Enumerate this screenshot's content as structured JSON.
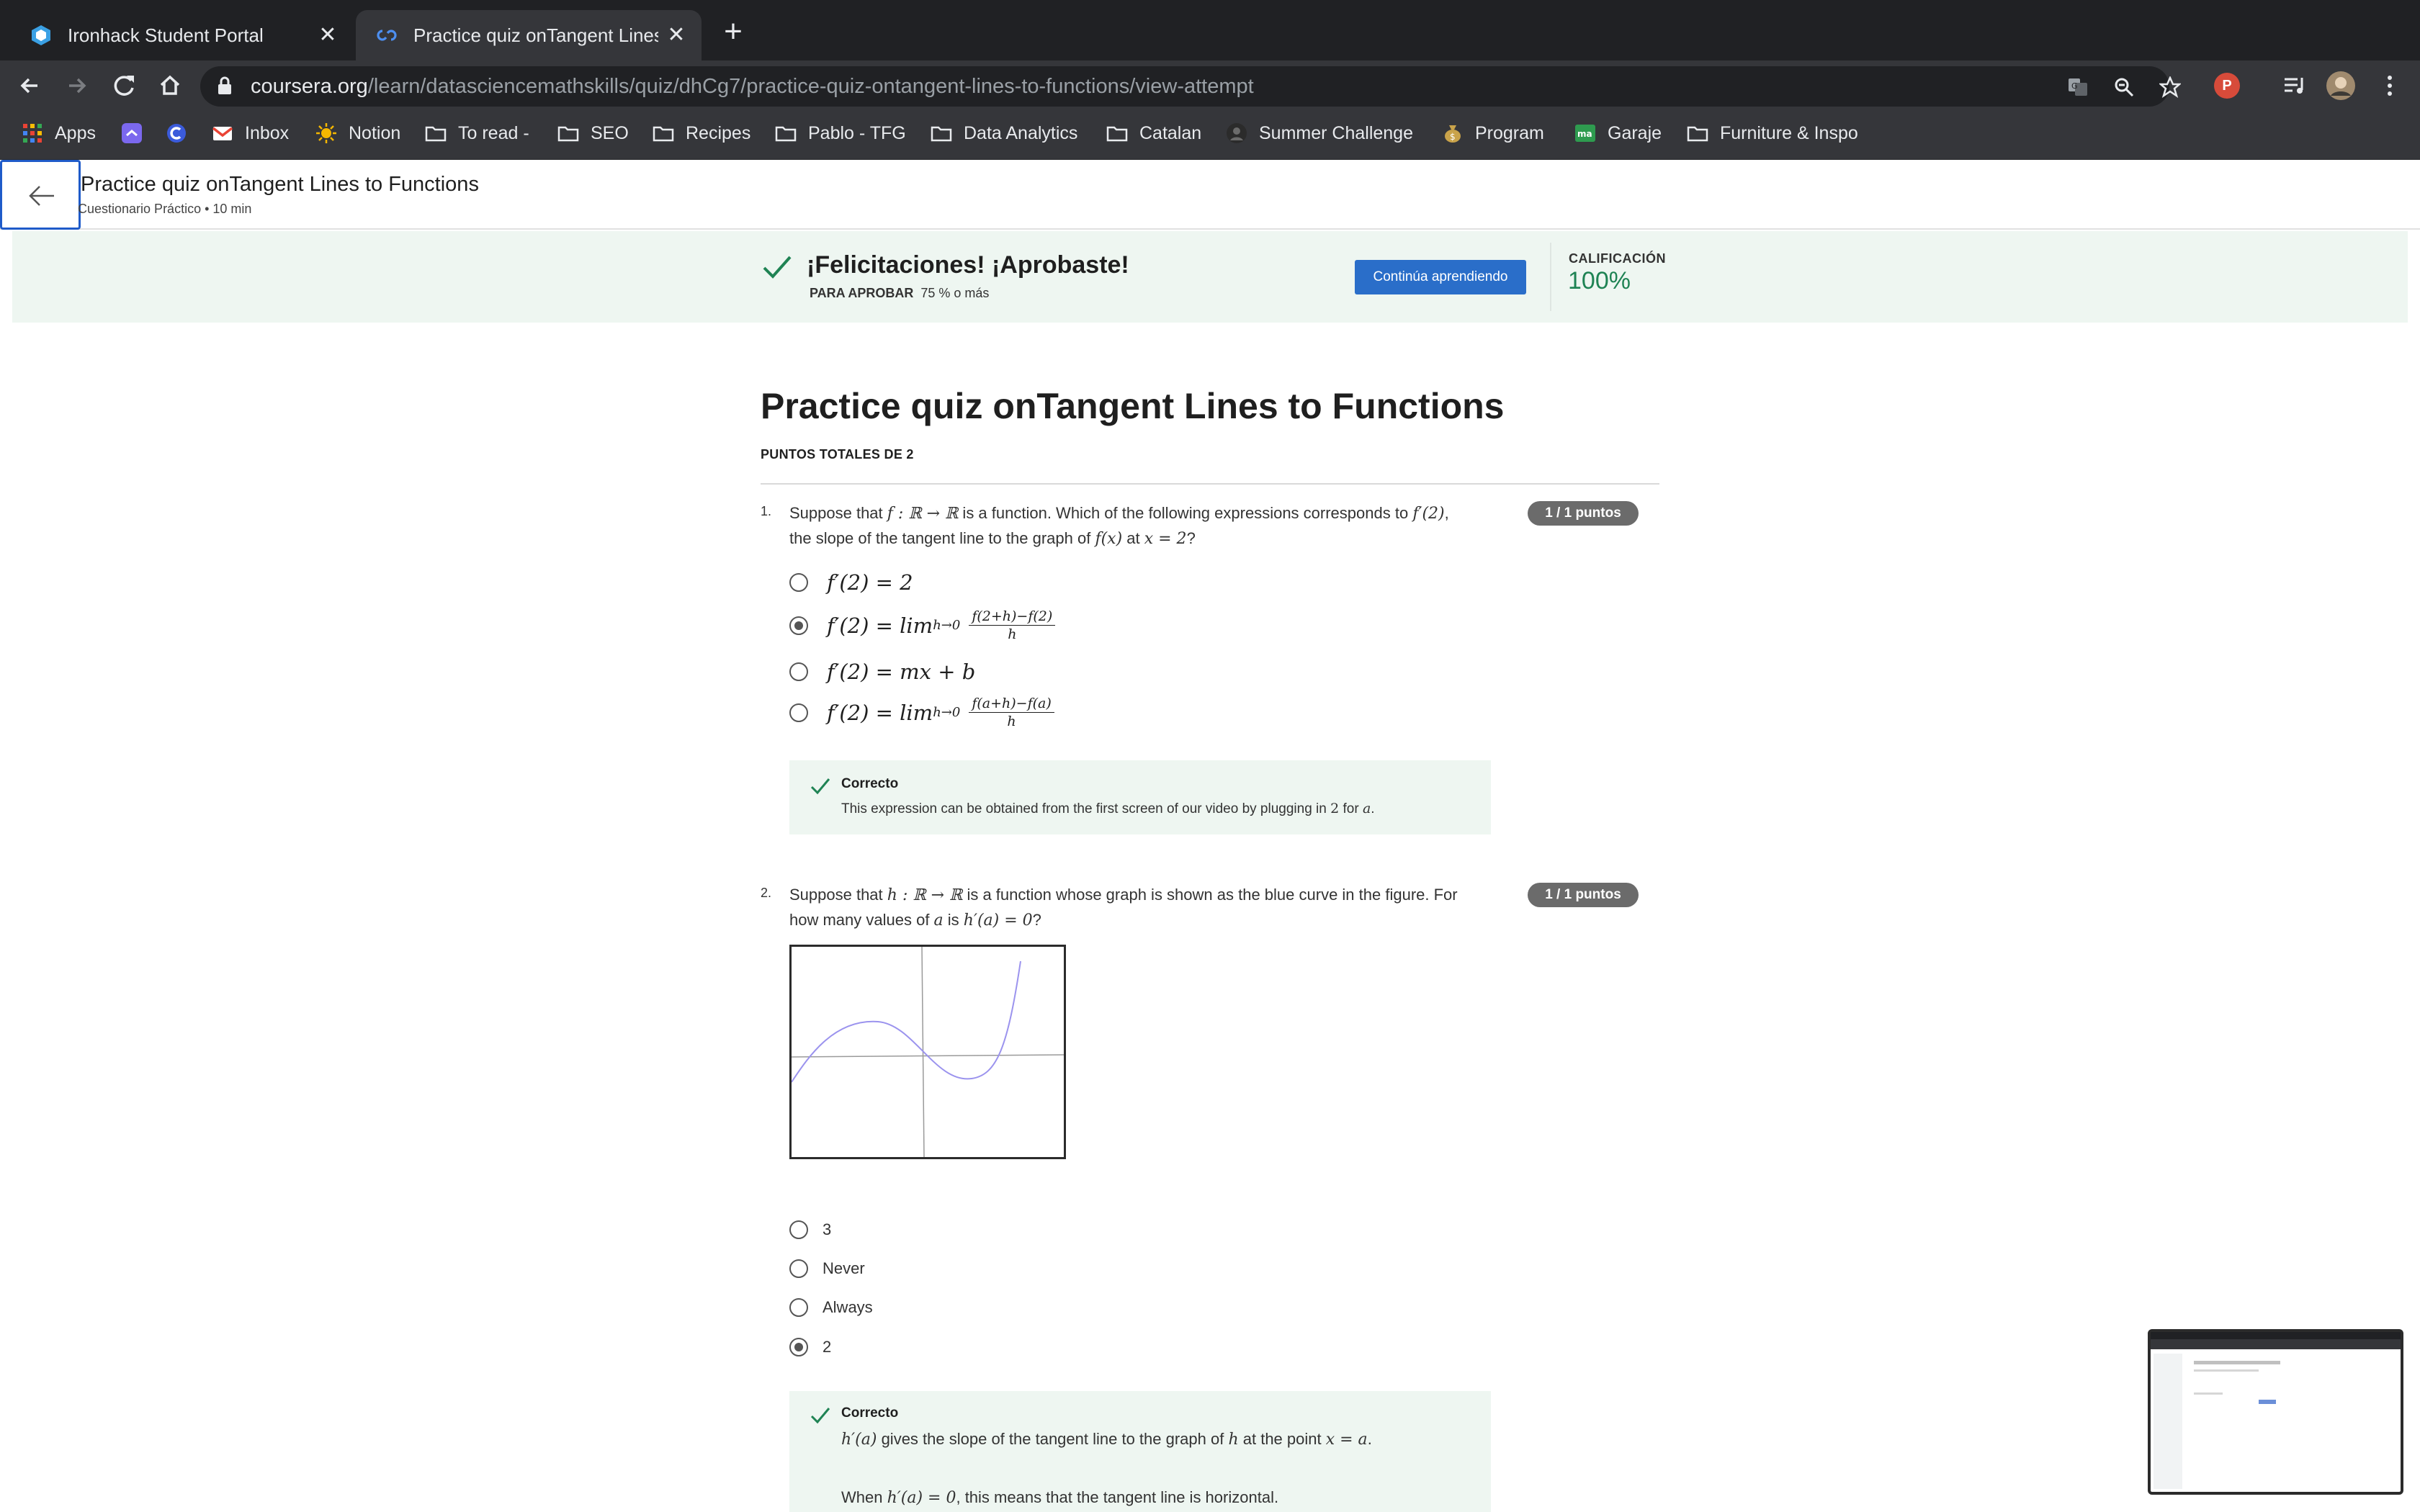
{
  "browser": {
    "tabs": [
      {
        "title": "Ironhack Student Portal",
        "active": false
      },
      {
        "title": "Practice quiz onTangent Lines to Functions",
        "active": true
      }
    ],
    "url_host": "coursera.org",
    "url_path": "/learn/datasciencemathskills/quiz/dhCg7/practice-quiz-ontangent-lines-to-functions/view-attempt",
    "profile_initial": "P",
    "bookmarks": [
      {
        "label": "Apps",
        "icon": "apps-grid-icon"
      },
      {
        "label": "",
        "icon": "clickup-icon"
      },
      {
        "label": "",
        "icon": "c-logo-icon"
      },
      {
        "label": "Inbox",
        "icon": "gmail-icon"
      },
      {
        "label": "Notion",
        "icon": "sun-icon"
      },
      {
        "label": "To read -",
        "icon": "folder-icon"
      },
      {
        "label": "SEO",
        "icon": "folder-icon"
      },
      {
        "label": "Recipes",
        "icon": "folder-icon"
      },
      {
        "label": "Pablo - TFG",
        "icon": "folder-icon"
      },
      {
        "label": "Data Analytics",
        "icon": "folder-icon"
      },
      {
        "label": "Catalan",
        "icon": "folder-icon"
      },
      {
        "label": "Summer Challenge",
        "icon": "avatar-icon"
      },
      {
        "label": "Program",
        "icon": "money-bag-icon"
      },
      {
        "label": "Garaje",
        "icon": "ma-logo-icon"
      },
      {
        "label": "Furniture & Inspo",
        "icon": "folder-icon"
      }
    ]
  },
  "header": {
    "title": "Practice quiz onTangent Lines to Functions",
    "subtitle": "Cuestionario Práctico • 10 min"
  },
  "banner": {
    "title": "¡Felicitaciones! ¡Aprobaste!",
    "pass_label": "PARA APROBAR",
    "pass_value": "75 % o más",
    "continue_label": "Continúa aprendiendo",
    "grade_label": "CALIFICACIÓN",
    "grade_value": "100%"
  },
  "quiz": {
    "title": "Practice quiz onTangent Lines to Functions",
    "total_points_label": "PUNTOS TOTALES DE 2",
    "questions": [
      {
        "number": "1.",
        "points": "1 / 1 puntos",
        "text_parts": [
          "Suppose that ",
          "f : ℝ → ℝ",
          " is a function. Which of the following expressions corresponds to ",
          "f′(2)",
          ",",
          "the slope of the tangent line to the graph of ",
          "f(x)",
          " at ",
          "x = 2",
          "?"
        ],
        "options": [
          {
            "lhs": "f′(2) = 2",
            "selected": false
          },
          {
            "lhs": "f′(2) = lim",
            "sub": "h→0",
            "num": "f(2+h)−f(2)",
            "den": "h",
            "selected": true
          },
          {
            "lhs": "f′(2) = mx + b",
            "selected": false
          },
          {
            "lhs": "f′(2) = lim",
            "sub": "h→0",
            "num": "f(a+h)−f(a)",
            "den": "h",
            "selected": false
          }
        ],
        "feedback_title": "Correcto",
        "feedback_parts": [
          "This expression can be obtained from the first screen of our video by plugging in ",
          "2",
          " for ",
          "a",
          "."
        ]
      },
      {
        "number": "2.",
        "points": "1 / 1 puntos",
        "text_parts": [
          "Suppose that ",
          "h : ℝ → ℝ",
          " is a function whose graph is shown as the blue curve in the figure. For",
          "how many values of ",
          "a",
          " is ",
          "h′(a) = 0",
          "?"
        ],
        "options": [
          {
            "label": "3",
            "selected": false
          },
          {
            "label": "Never",
            "selected": false
          },
          {
            "label": "Always",
            "selected": false
          },
          {
            "label": "2",
            "selected": true
          }
        ],
        "feedback_title": "Correcto",
        "feedback_line1": [
          "h′(a)",
          " gives the slope of the tangent line to the graph of ",
          "h",
          " at the point ",
          "x = a",
          "."
        ],
        "feedback_line2": [
          "When ",
          "h′(a) = 0",
          ", this means that the tangent line is horizontal."
        ]
      }
    ]
  },
  "colors": {
    "banner_bg": "#eef6f1",
    "check_green": "#1f8354",
    "button_blue": "#2a6ec9",
    "badge_gray": "#6b6b6b",
    "curve_blue": "#9b93ee"
  }
}
